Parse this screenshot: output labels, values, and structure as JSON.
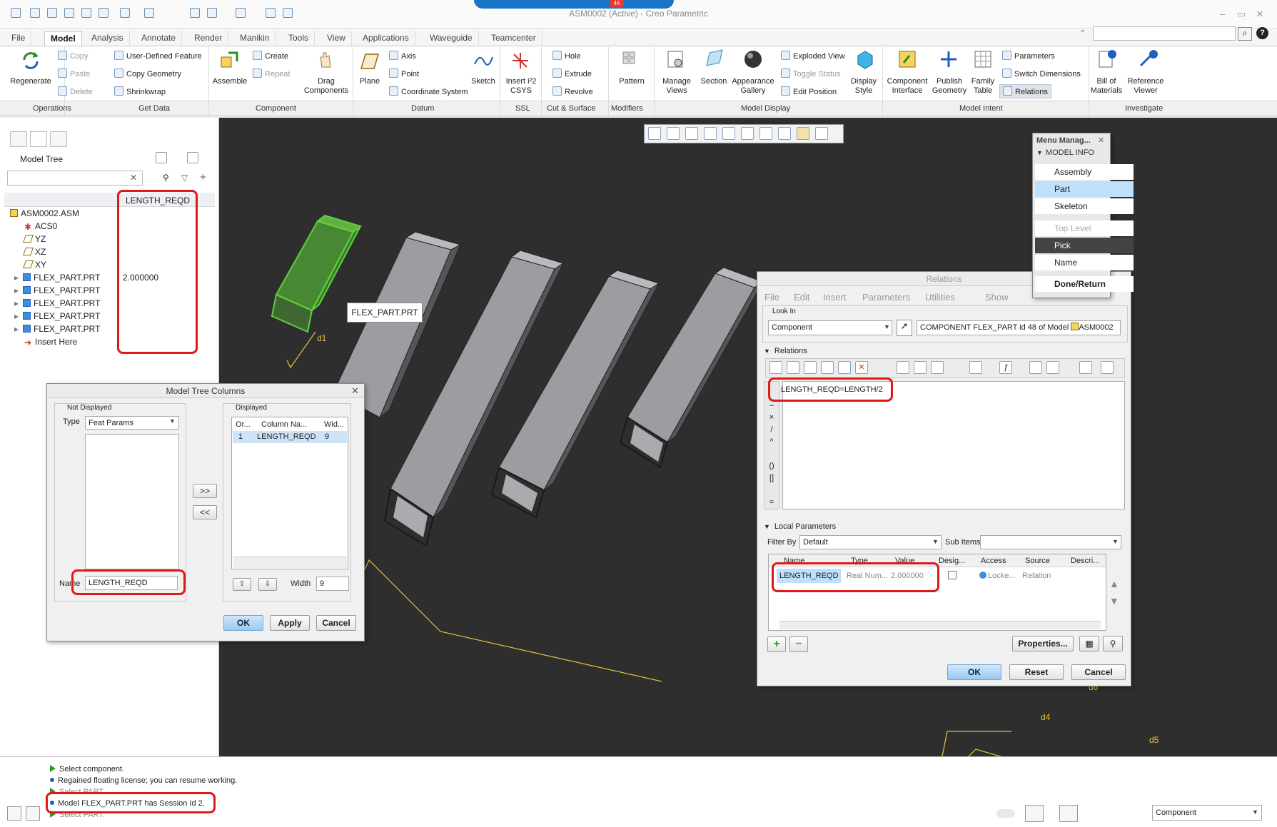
{
  "window": {
    "title": "ASM0002 (Active) - Creo Parametric",
    "notification_count": "44"
  },
  "tabs": [
    "File",
    "Model",
    "Analysis",
    "Annotate",
    "Render",
    "Manikin",
    "Tools",
    "View",
    "Applications",
    "Waveguide",
    "Teamcenter"
  ],
  "ribbon": {
    "regenerate": "Regenerate",
    "copy": "Copy",
    "paste": "Paste",
    "delete": "Delete",
    "udf": "User-Defined Feature",
    "copy_geometry": "Copy Geometry",
    "shrinkwrap": "Shrinkwrap",
    "assemble": "Assemble",
    "create": "Create",
    "repeat": "Repeat",
    "drag_components_1": "Drag",
    "drag_components_2": "Components",
    "plane": "Plane",
    "axis": "Axis",
    "point": "Point",
    "coordinate_system": "Coordinate System",
    "sketch": "Sketch",
    "insert_csys_1": "Insert i²2",
    "insert_csys_2": "CSYS",
    "hole": "Hole",
    "extrude": "Extrude",
    "revolve": "Revolve",
    "pattern": "Pattern",
    "manage_views_1": "Manage",
    "manage_views_2": "Views",
    "section": "Section",
    "appearance_1": "Appearance",
    "appearance_2": "Gallery",
    "exploded_view": "Exploded View",
    "toggle_status": "Toggle Status",
    "edit_position": "Edit Position",
    "display_style_1": "Display",
    "display_style_2": "Style",
    "component_interface_1": "Component",
    "component_interface_2": "Interface",
    "publish_geometry_1": "Publish",
    "publish_geometry_2": "Geometry",
    "family_table_1": "Family",
    "family_table_2": "Table",
    "parameters": "Parameters",
    "switch_dimensions": "Switch Dimensions",
    "relations": "Relations",
    "bom_1": "Bill of",
    "bom_2": "Materials",
    "reference_viewer_1": "Reference",
    "reference_viewer_2": "Viewer"
  },
  "groups": [
    "Operations",
    "Get Data",
    "Component",
    "Datum",
    "SSL",
    "Cut & Surface",
    "Modifiers",
    "Model Display",
    "Model Intent",
    "Investigate"
  ],
  "model_tree": {
    "title": "Model Tree",
    "column_header": "LENGTH_REQD",
    "items": [
      {
        "label": "ASM0002.ASM",
        "value": ""
      },
      {
        "label": "ACS0",
        "value": ""
      },
      {
        "label": "YZ",
        "value": ""
      },
      {
        "label": "XZ",
        "value": ""
      },
      {
        "label": "XY",
        "value": ""
      },
      {
        "label": "FLEX_PART.PRT",
        "value": "2.000000"
      },
      {
        "label": "FLEX_PART.PRT",
        "value": ""
      },
      {
        "label": "FLEX_PART.PRT",
        "value": ""
      },
      {
        "label": "FLEX_PART.PRT",
        "value": ""
      },
      {
        "label": "FLEX_PART.PRT",
        "value": ""
      },
      {
        "label": "Insert Here",
        "value": ""
      }
    ]
  },
  "viewport": {
    "tooltip": "FLEX_PART.PRT",
    "dim_labels": [
      "d1",
      "d6",
      "d4",
      "d5"
    ]
  },
  "menu_manager": {
    "title": "Menu Manag...",
    "section": "MODEL INFO",
    "items": [
      "Assembly",
      "Part",
      "Skeleton",
      "Top Level",
      "Pick",
      "Name",
      "Done/Return"
    ]
  },
  "mtc_dialog": {
    "title": "Model Tree Columns",
    "not_displayed": "Not Displayed",
    "type_label": "Type",
    "type_value": "Feat Params",
    "displayed": "Displayed",
    "col_order": "Or...",
    "col_name": "Column Na...",
    "col_width": "Wid...",
    "row": {
      "order": "1",
      "name": "LENGTH_REQD",
      "width": "9"
    },
    "add_button": ">>",
    "remove_button": "<<",
    "name_label": "Name",
    "name_value": "LENGTH_REQD",
    "width_label": "Width",
    "width_value": "9",
    "ok": "OK",
    "apply": "Apply",
    "cancel": "Cancel"
  },
  "relations_dialog": {
    "title": "Relations",
    "menus": [
      "File",
      "Edit",
      "Insert",
      "Parameters",
      "Utilities",
      "Show"
    ],
    "look_in_label": "Look In",
    "look_in_value": "Component",
    "component_value": "COMPONENT FLEX_PART id 48 of Model",
    "model_value": "ASM0002",
    "relations_label": "Relations",
    "relation_text": "LENGTH_REQD=LENGTH/2",
    "local_params_label": "Local Parameters",
    "filter_label": "Filter By",
    "filter_value": "Default",
    "subitems_label": "Sub Items",
    "columns": [
      "Name",
      "Type",
      "Value",
      "Desig...",
      "Access",
      "Source",
      "Descri..."
    ],
    "row": {
      "name": "LENGTH_REQD",
      "type": "Real Num...",
      "value": "2.000000",
      "access": "Locke...",
      "source": "Relation"
    },
    "properties": "Properties...",
    "ok": "OK",
    "reset": "Reset",
    "cancel": "Cancel"
  },
  "status": {
    "messages": [
      {
        "kind": "prompt",
        "text": "Select component."
      },
      {
        "kind": "info",
        "text": "Regained floating license; you can resume working."
      },
      {
        "kind": "prompt",
        "text": "Select PART."
      },
      {
        "kind": "info",
        "text": "Model FLEX_PART.PRT has Session Id 2."
      },
      {
        "kind": "prompt",
        "text": "Select PART."
      }
    ],
    "filter_value": "Component"
  },
  "colors": {
    "highlight_red": "#e01818",
    "selection_green": "#5fd13a",
    "viewport_bg": "#2e2e2e",
    "accent_blue": "#1976c7"
  }
}
